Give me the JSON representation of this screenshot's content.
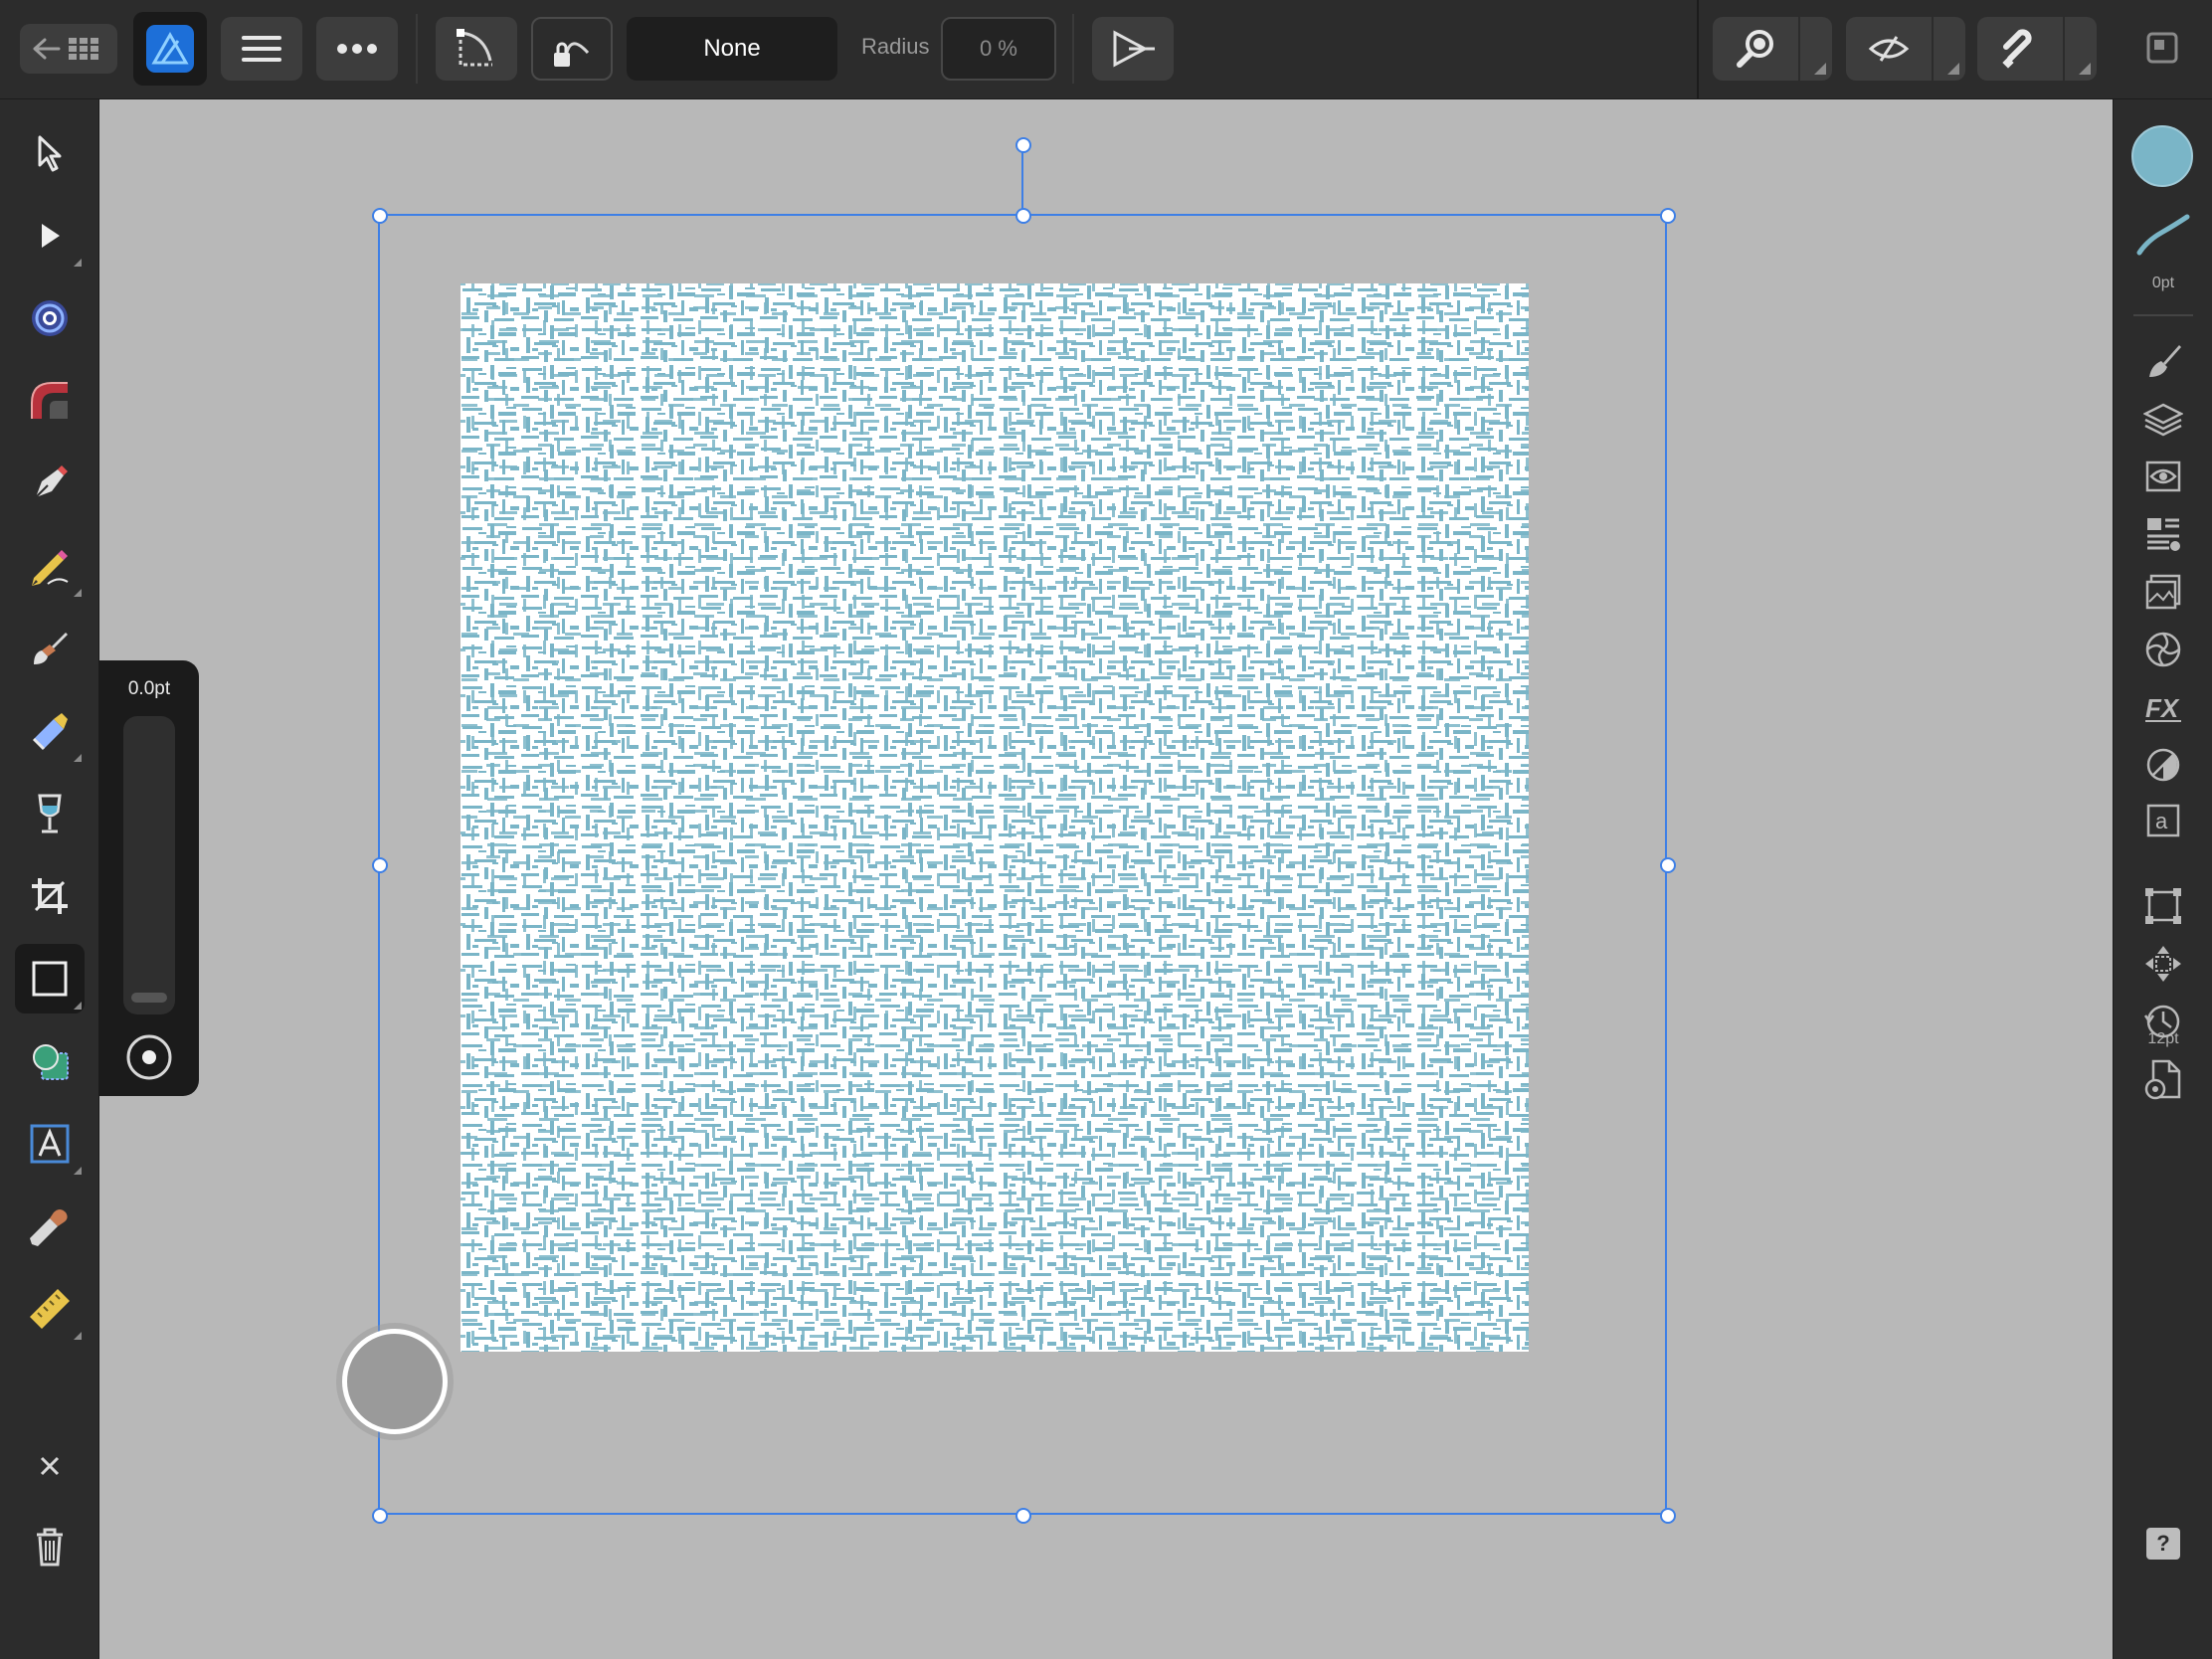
{
  "app": {
    "name": "Affinity Designer"
  },
  "colors": {
    "accent": "#3d7fe6",
    "fill": "#7ab5c7",
    "canvas_bg": "#b8b8b8",
    "ui_dark": "#2c2c2c"
  },
  "toolbar": {
    "back_icon": "back-grid-icon",
    "persona_icon": "designer-persona-icon",
    "menu_icon": "hamburger-menu-icon",
    "more_icon": "more-dots-icon",
    "corner_value": "None",
    "radius_label": "Radius",
    "radius_value": "0 %",
    "export_icon": "export-persona-icon",
    "zoom_icon": "zoom-icon",
    "view_icon": "view-mode-icon",
    "snap_icon": "snapping-magnet-icon",
    "window_icon": "window-icon"
  },
  "left_tools": [
    {
      "name": "move-tool",
      "icon": "move-arrow-icon"
    },
    {
      "name": "node-tool",
      "icon": "node-arrow-icon"
    },
    {
      "name": "contour-tool",
      "icon": "contour-icon"
    },
    {
      "name": "corner-tool",
      "icon": "corner-icon"
    },
    {
      "name": "pen-tool",
      "icon": "pen-nib-icon"
    },
    {
      "name": "pencil-tool",
      "icon": "pencil-icon"
    },
    {
      "name": "vector-brush-tool",
      "icon": "brush-icon"
    },
    {
      "name": "fill-tool",
      "icon": "gradient-fill-icon"
    },
    {
      "name": "transparency-tool",
      "icon": "glass-icon"
    },
    {
      "name": "crop-tool",
      "icon": "crop-icon"
    },
    {
      "name": "rectangle-tool",
      "icon": "rectangle-icon",
      "active": true
    },
    {
      "name": "shape-tool",
      "icon": "shapes-icon"
    },
    {
      "name": "text-tool",
      "icon": "text-icon"
    },
    {
      "name": "color-picker-tool",
      "icon": "eyedropper-icon"
    },
    {
      "name": "measure-tool",
      "icon": "ruler-icon"
    }
  ],
  "left_bottom": {
    "close_icon": "close-icon",
    "delete_icon": "trash-icon"
  },
  "width_popover": {
    "value": "0.0pt",
    "slider_fraction": 0.0
  },
  "studio": {
    "stroke_width": "0pt",
    "text_size": "12pt",
    "panels": [
      "brushes-icon",
      "layers-icon",
      "appearance-icon",
      "stroke-icon",
      "assets-icon",
      "swatches-icon",
      "fx-icon",
      "transparency-icon",
      "character-icon",
      "transform-icon",
      "navigator-icon",
      "history-icon",
      "document-settings-icon"
    ],
    "help": "?"
  }
}
